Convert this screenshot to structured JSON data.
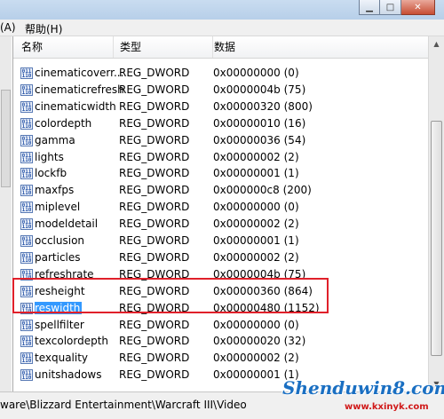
{
  "menu": {
    "left_fragment": "(A)",
    "help": "帮助(H)"
  },
  "columns": {
    "name": "名称",
    "type": "类型",
    "data": "数据"
  },
  "rows": [
    {
      "name": "cinematicoverr...",
      "type": "REG_DWORD",
      "data": "0x00000000 (0)"
    },
    {
      "name": "cinematicrefresh",
      "type": "REG_DWORD",
      "data": "0x0000004b (75)"
    },
    {
      "name": "cinematicwidth",
      "type": "REG_DWORD",
      "data": "0x00000320 (800)"
    },
    {
      "name": "colordepth",
      "type": "REG_DWORD",
      "data": "0x00000010 (16)"
    },
    {
      "name": "gamma",
      "type": "REG_DWORD",
      "data": "0x00000036 (54)"
    },
    {
      "name": "lights",
      "type": "REG_DWORD",
      "data": "0x00000002 (2)"
    },
    {
      "name": "lockfb",
      "type": "REG_DWORD",
      "data": "0x00000001 (1)"
    },
    {
      "name": "maxfps",
      "type": "REG_DWORD",
      "data": "0x000000c8 (200)"
    },
    {
      "name": "miplevel",
      "type": "REG_DWORD",
      "data": "0x00000000 (0)"
    },
    {
      "name": "modeldetail",
      "type": "REG_DWORD",
      "data": "0x00000002 (2)"
    },
    {
      "name": "occlusion",
      "type": "REG_DWORD",
      "data": "0x00000001 (1)"
    },
    {
      "name": "particles",
      "type": "REG_DWORD",
      "data": "0x00000002 (2)"
    },
    {
      "name": "refreshrate",
      "type": "REG_DWORD",
      "data": "0x0000004b (75)"
    },
    {
      "name": "resheight",
      "type": "REG_DWORD",
      "data": "0x00000360 (864)"
    },
    {
      "name": "reswidth",
      "type": "REG_DWORD",
      "data": "0x00000480 (1152)"
    },
    {
      "name": "spellfilter",
      "type": "REG_DWORD",
      "data": "0x00000000 (0)"
    },
    {
      "name": "texcolordepth",
      "type": "REG_DWORD",
      "data": "0x00000020 (32)"
    },
    {
      "name": "texquality",
      "type": "REG_DWORD",
      "data": "0x00000002 (2)"
    },
    {
      "name": "unitshadows",
      "type": "REG_DWORD",
      "data": "0x00000001 (1)"
    }
  ],
  "selected_row": "reswidth",
  "value_icon": "reg-dword-value-icon",
  "status": {
    "path": "ware\\Blizzard Entertainment\\Warcraft III\\Video"
  },
  "watermark": {
    "main": "Shenduwin8.com",
    "sub": "www.kxinyk.com"
  },
  "colors": {
    "selection": "#3399ff",
    "highlight_box": "#e0202a",
    "watermark": "#1a6fc2"
  }
}
